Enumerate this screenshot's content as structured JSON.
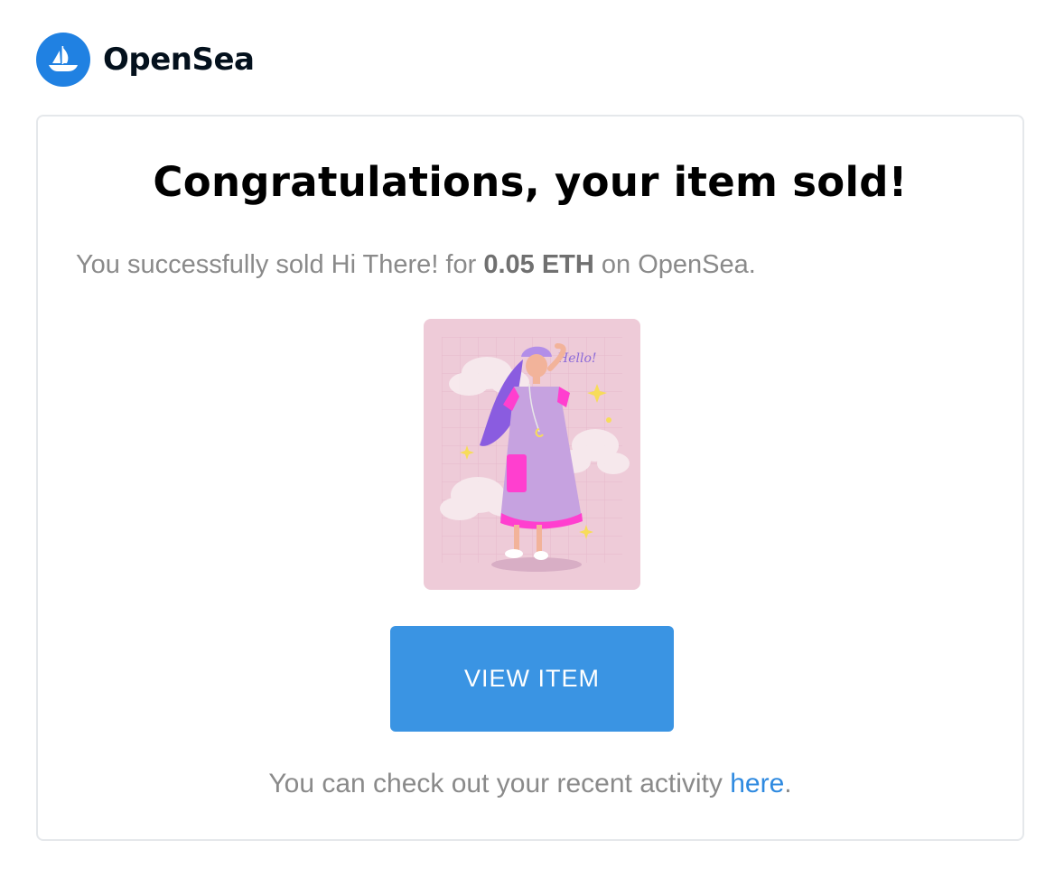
{
  "brand": {
    "name": "OpenSea",
    "color": "#2081e2"
  },
  "email": {
    "headline": "Congratulations, your item sold!",
    "message": {
      "prefix": "You successfully sold Hi There! for ",
      "price": "0.05 ETH",
      "suffix": " on OpenSea."
    },
    "item_image": {
      "icon": "nft-artwork-hello-girl",
      "caption_text": "Hello!"
    },
    "button_label": "VIEW ITEM",
    "button_color": "#3a94e3",
    "footer": {
      "prefix": "You can check out your recent activity ",
      "link_text": "here",
      "suffix": "."
    }
  }
}
